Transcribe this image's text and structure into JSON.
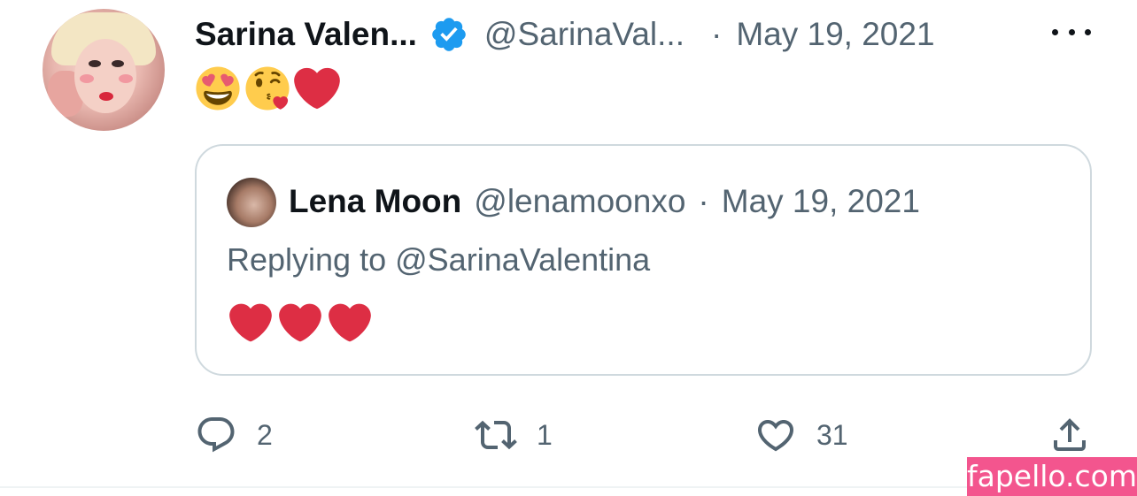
{
  "tweet": {
    "author": {
      "display_name": "Sarina Valen...",
      "handle": "@SarinaVal...",
      "verified": true
    },
    "separator": "·",
    "date": "May 19, 2021",
    "text_emojis": [
      "smiling-face-with-heart-eyes",
      "face-blowing-a-kiss",
      "red-heart"
    ],
    "quoted_tweet": {
      "author": {
        "display_name": "Lena Moon",
        "handle": "@lenamoonxo"
      },
      "separator": "·",
      "date": "May 19, 2021",
      "reply_prefix": "Replying to",
      "reply_to": "@SarinaValentina",
      "text_emojis": [
        "red-heart",
        "red-heart",
        "red-heart"
      ]
    },
    "actions": {
      "reply_count": "2",
      "retweet_count": "1",
      "like_count": "31"
    }
  },
  "watermark": "fapello.com",
  "colors": {
    "primary_text": "#0f1419",
    "secondary_text": "#536471",
    "verified_blue": "#1d9bf0",
    "heart_red": "#dd2e44",
    "border": "#cfd9de",
    "watermark_bg": "#f3558e"
  }
}
